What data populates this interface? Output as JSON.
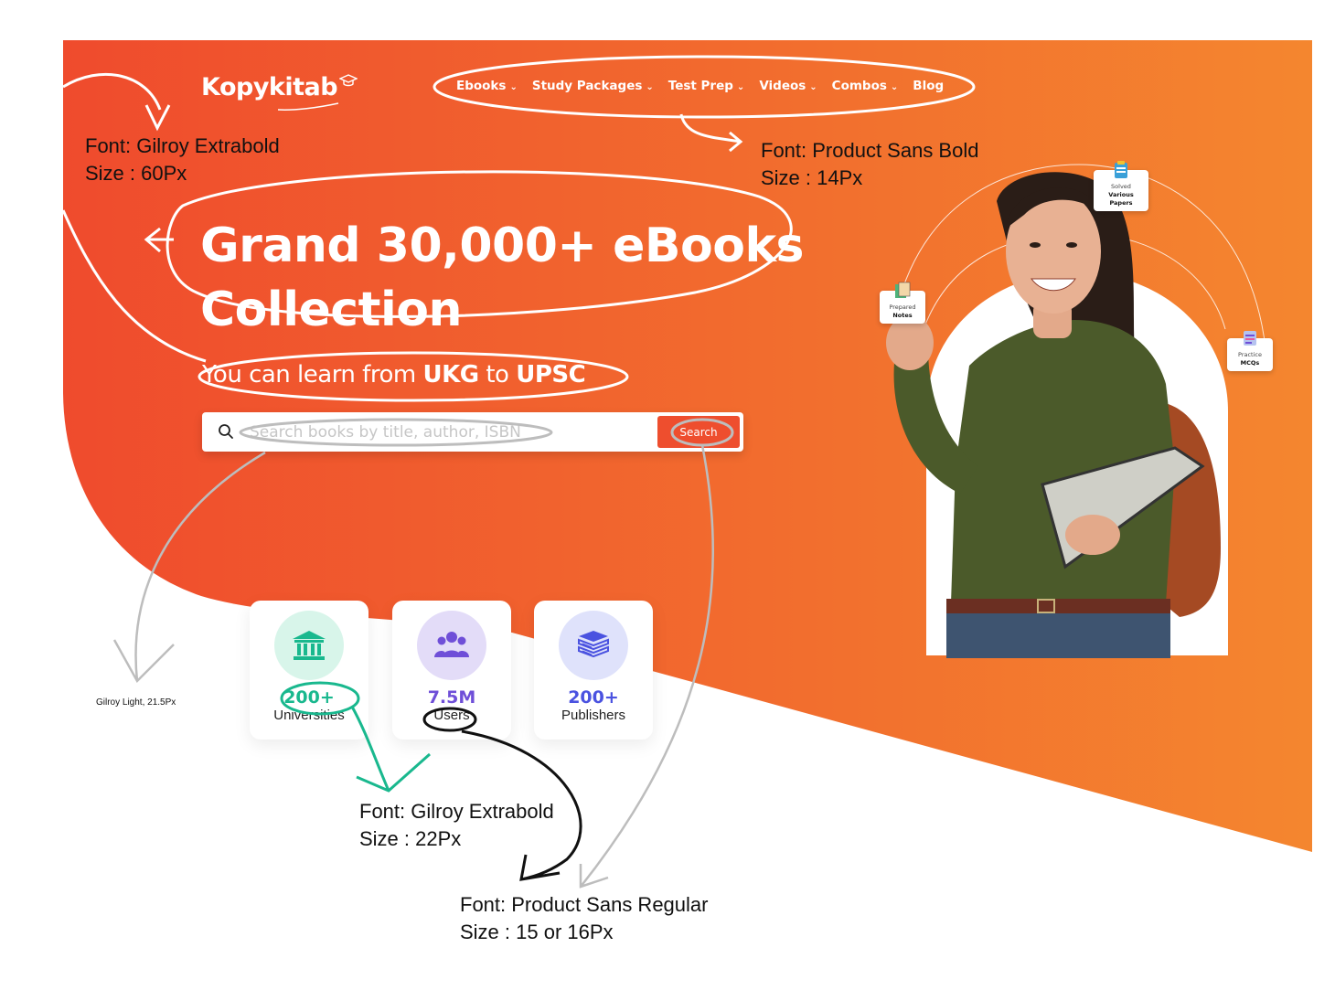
{
  "brand": {
    "name": "Kopykitab"
  },
  "nav": {
    "items": [
      {
        "label": "Ebooks",
        "has_dropdown": true
      },
      {
        "label": "Study Packages",
        "has_dropdown": true
      },
      {
        "label": "Test Prep",
        "has_dropdown": true
      },
      {
        "label": "Videos",
        "has_dropdown": true
      },
      {
        "label": "Combos",
        "has_dropdown": true
      },
      {
        "label": "Blog",
        "has_dropdown": false
      }
    ]
  },
  "hero": {
    "title_line1": "Grand 30,000+ eBooks",
    "title_line2": "Collection",
    "subtitle_prefix": "You can learn from ",
    "subtitle_b1": "UKG",
    "subtitle_mid": " to ",
    "subtitle_b2": "UPSC"
  },
  "search": {
    "placeholder": "Search books by title, author, ISBN",
    "value": "",
    "button_label": "Search"
  },
  "stats": [
    {
      "value": "200+",
      "label": "Universities",
      "icon": "bank-icon",
      "color": "#19b88e",
      "bg": "#d8f5ea"
    },
    {
      "value": "7.5M",
      "label": "Users",
      "icon": "users-icon",
      "color": "#6f4fd8",
      "bg": "#e3dcf8"
    },
    {
      "value": "200+",
      "label": "Publishers",
      "icon": "books-icon",
      "color": "#4a52e0",
      "bg": "#dfe2fb"
    }
  ],
  "photo_tags": [
    {
      "line1": "Solved",
      "line2": "Various Papers"
    },
    {
      "line1": "Prepared",
      "line2": "Notes"
    },
    {
      "line1": "Practice",
      "line2": "MCQs"
    }
  ],
  "annotations": {
    "logo_font": "Font: Gilroy Extrabold",
    "logo_size": "Size : 60Px",
    "nav_font": "Font: Product Sans Bold",
    "nav_size": "Size : 14Px",
    "search_font": "Gilroy Light, 21.5Px",
    "stat_font": "Font: Gilroy Extrabold",
    "stat_size": "Size : 22Px",
    "label_font": "Font: Product Sans Regular",
    "label_size": "Size : 15 or 16Px"
  },
  "colors": {
    "gradient_start": "#ef4b2d",
    "gradient_end": "#f4872f",
    "accent": "#ee4e2e"
  }
}
